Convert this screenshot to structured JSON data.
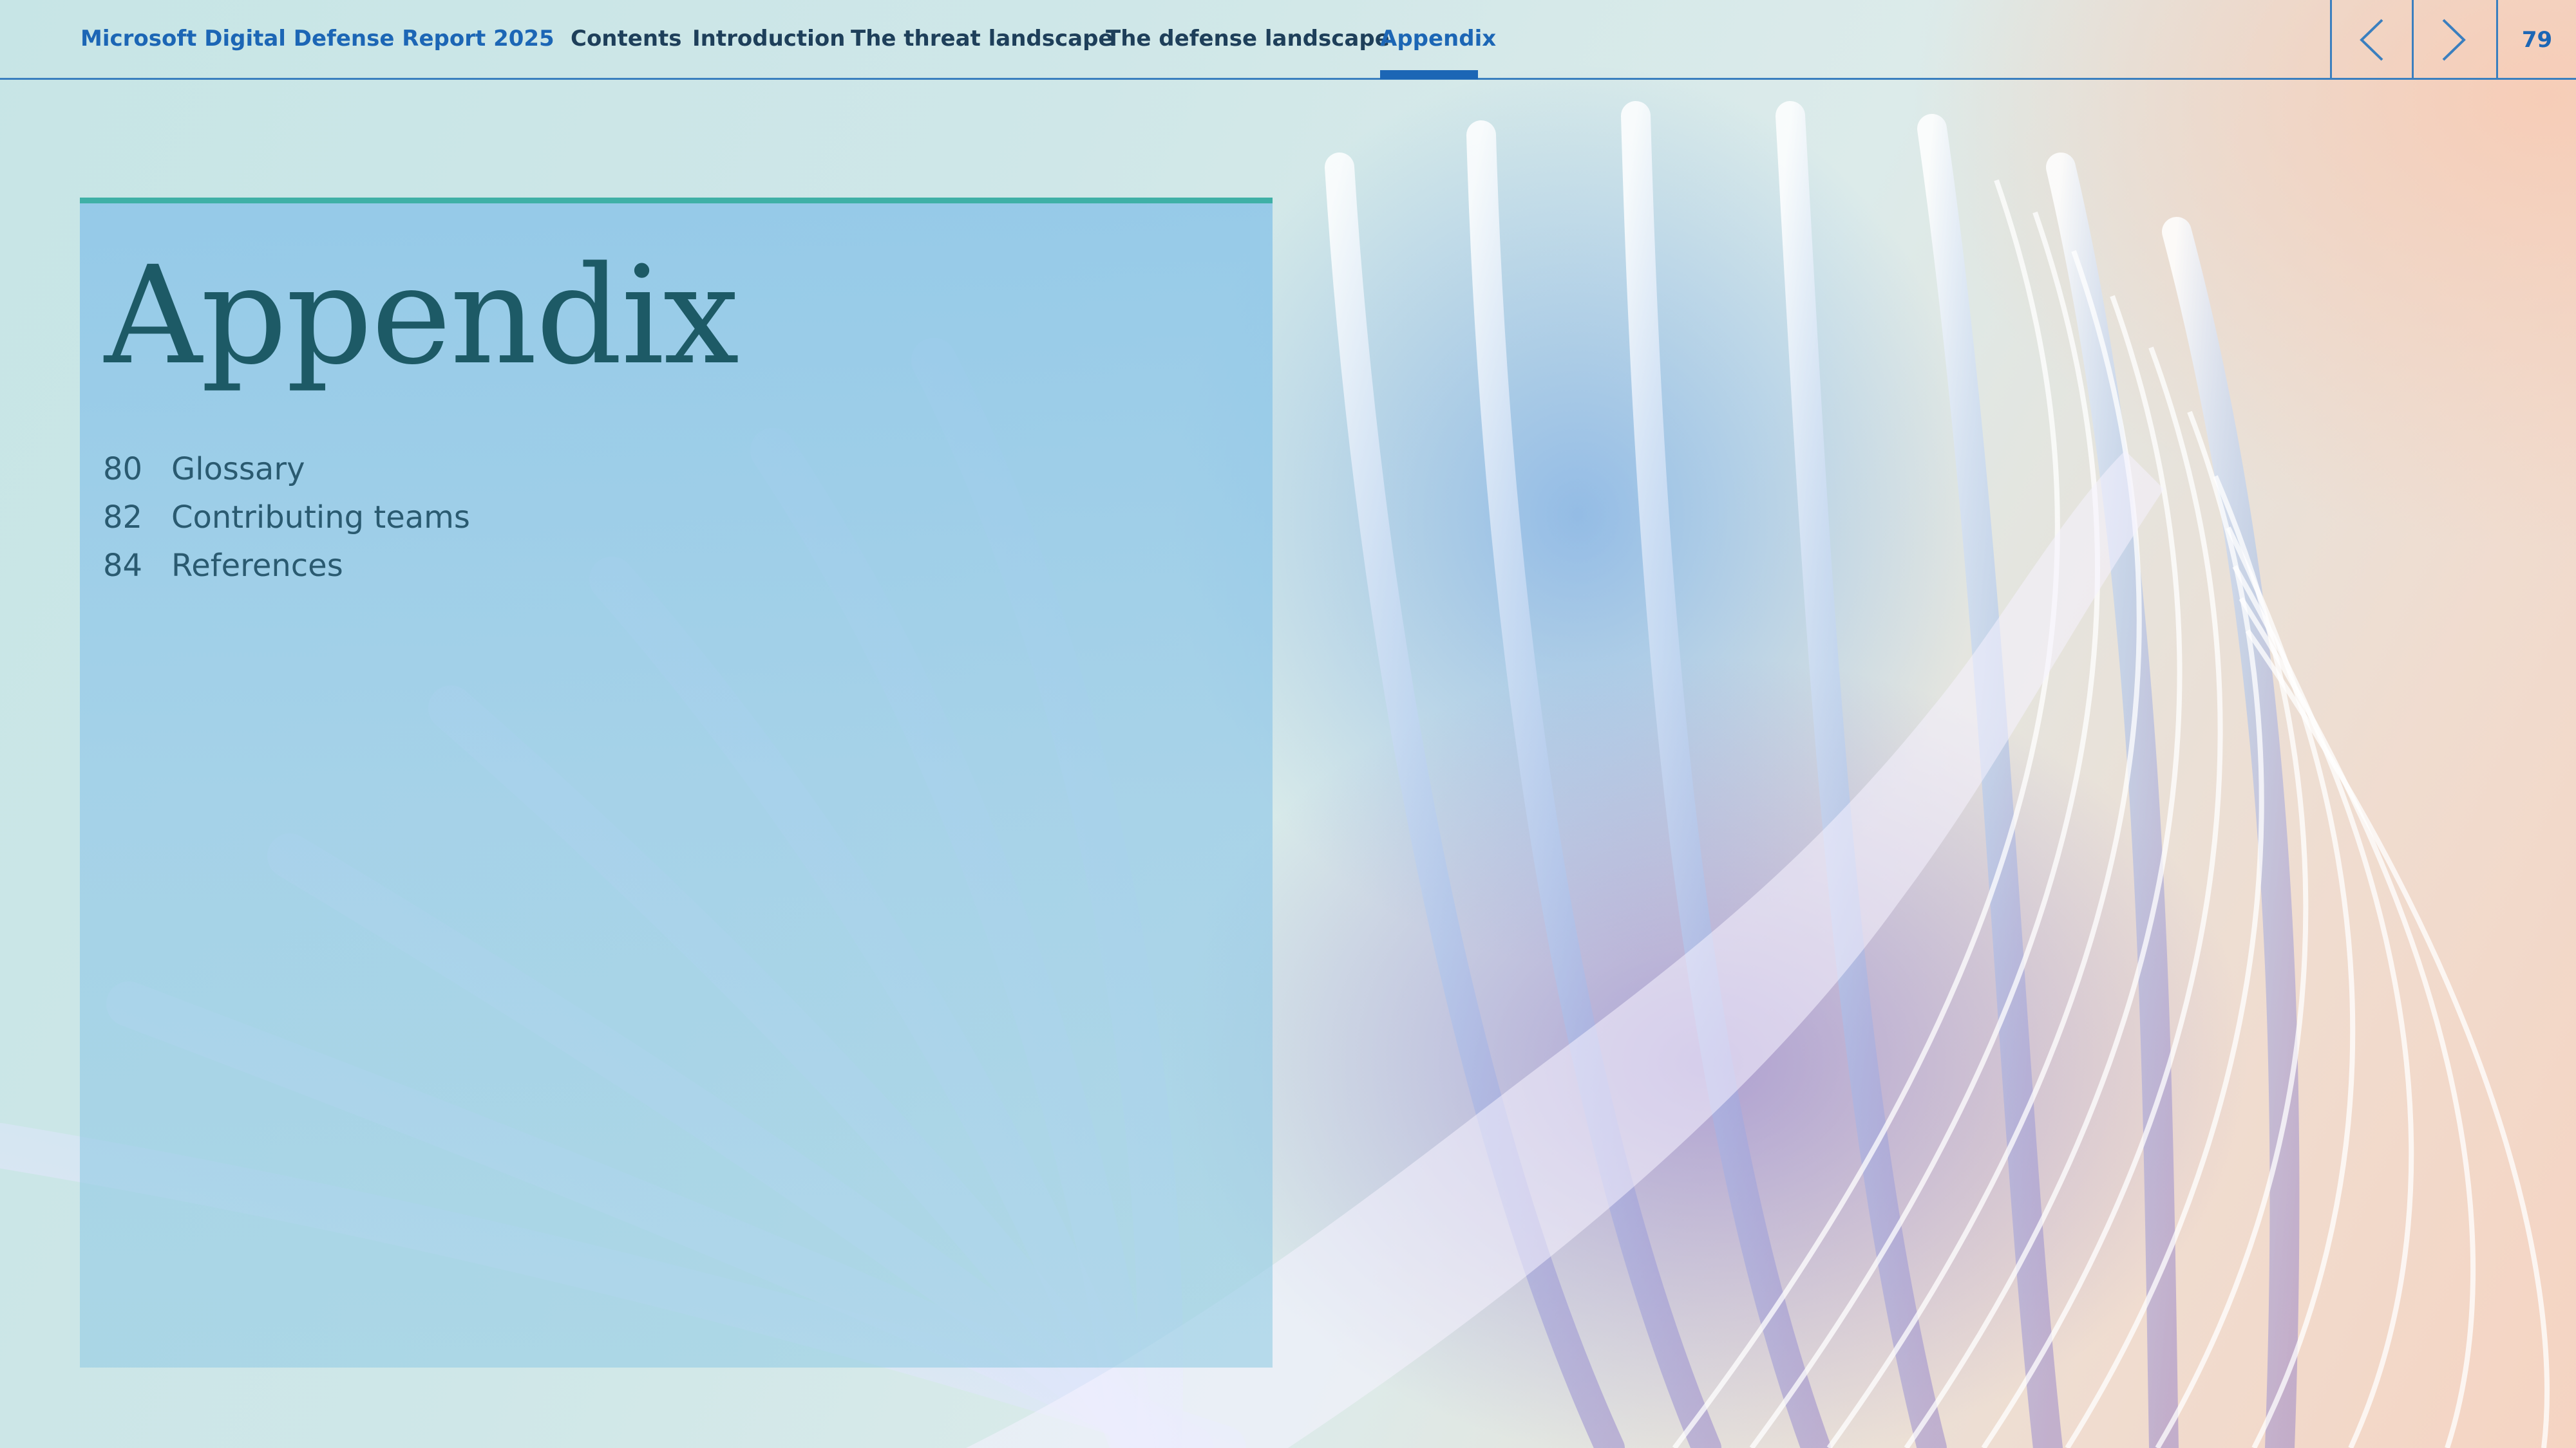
{
  "header": {
    "report_title": "Microsoft Digital Defense Report 2025",
    "nav": [
      {
        "label": "Contents"
      },
      {
        "label": "Introduction"
      },
      {
        "label": "The threat landscape"
      },
      {
        "label": "The defense landscape"
      },
      {
        "label": "Appendix",
        "active": true
      }
    ],
    "prev_icon": "chevron-left-icon",
    "next_icon": "chevron-right-icon",
    "page_number": "79"
  },
  "appendix": {
    "title": "Appendix",
    "items": [
      {
        "page": "80",
        "label": "Glossary"
      },
      {
        "page": "82",
        "label": "Contributing teams"
      },
      {
        "page": "84",
        "label": "References"
      }
    ]
  },
  "colors": {
    "accent_blue": "#1c66b5",
    "nav_text": "#1e3f5a",
    "divider": "#3a7fbf",
    "panel_top_border": "#3fb0a6",
    "title_text": "#1d5a66",
    "toc_text": "#2a5a70"
  }
}
